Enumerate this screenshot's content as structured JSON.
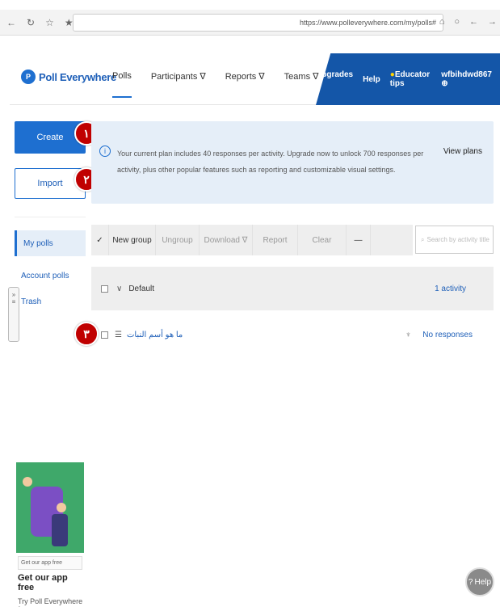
{
  "browser": {
    "url": "https://www.polleverywhere.com/my/polls#",
    "left_icons": [
      "←",
      "↻",
      "☆",
      "★",
      "☆"
    ],
    "right_icons": [
      "⌂",
      "○",
      "←",
      "→"
    ]
  },
  "header": {
    "logo_mark": "P",
    "logo_text": "Poll Everywhere",
    "nav": [
      "Polls",
      "Participants ∇",
      "Reports ∇",
      "Teams ∇"
    ],
    "right": {
      "upgrades": "Upgrades ∇",
      "help": "Help",
      "tips": "Educator tips",
      "user": "wfbihdwd867"
    },
    "colors": {
      "brand": "#1e6fd0",
      "header_right": "#1456a8"
    }
  },
  "actions": {
    "create": "Create",
    "import": "Import"
  },
  "badges": [
    "١",
    "٢",
    "٣"
  ],
  "banner": {
    "icon": "i",
    "text": "Your current plan includes 40 responses per activity. Upgrade now to unlock 700 responses per activity, plus other popular features such as reporting and customizable visual settings.",
    "link": "View plans"
  },
  "sidebar": {
    "items": [
      "My polls",
      "Account polls",
      "Trash"
    ]
  },
  "toolbar": {
    "check": "✓",
    "items": [
      "New group",
      "Ungroup",
      "Download ∇",
      "Report",
      "Clear",
      "—"
    ],
    "search_placeholder": "Search by activity title"
  },
  "group": {
    "name": "Default",
    "count": "1 activity"
  },
  "poll": {
    "title": "ما هو أسم النبات",
    "status": "No responses"
  },
  "promo": {
    "tag": "Get our app free",
    "title": "Get our app free",
    "sub": "Try Poll Everywhere for"
  },
  "help_button": "Help"
}
